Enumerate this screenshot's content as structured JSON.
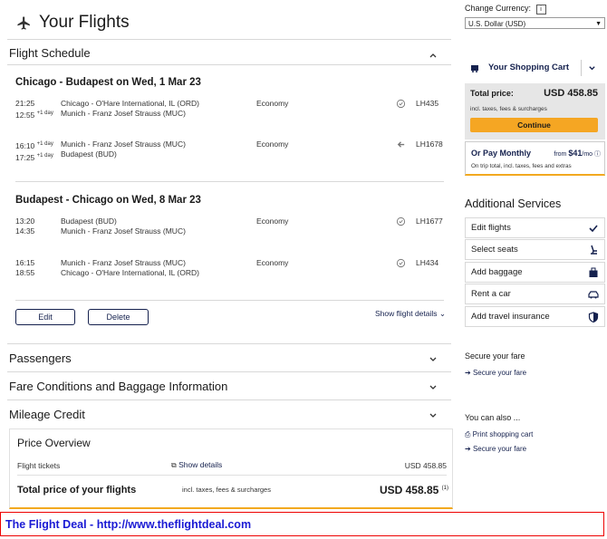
{
  "header": {
    "title": "Your Flights",
    "plane_icon": "plane-icon"
  },
  "schedule": {
    "section_title": "Flight Schedule",
    "outbound": {
      "route": "Chicago - Budapest on Wed, 1 Mar 23",
      "segments": [
        {
          "dep_time": "21:25",
          "dep_suffix": "",
          "arr_time": "12:55",
          "arr_suffix": "+1 day",
          "from": "Chicago - O'Hare International, IL (ORD)",
          "to": "Munich - Franz Josef Strauss (MUC)",
          "cabin": "Economy",
          "flight": "LH435",
          "icon": "clock-icon"
        },
        {
          "dep_time": "16:10",
          "dep_suffix": "+1 day",
          "arr_time": "17:25",
          "arr_suffix": "+1 day",
          "from": "Munich - Franz Josef Strauss (MUC)",
          "to": "Budapest (BUD)",
          "cabin": "Economy",
          "flight": "LH1678",
          "icon": "arrow-left-icon"
        }
      ]
    },
    "inbound": {
      "route": "Budapest - Chicago on Wed, 8 Mar 23",
      "segments": [
        {
          "dep_time": "13:20",
          "dep_suffix": "",
          "arr_time": "14:35",
          "arr_suffix": "",
          "from": "Budapest (BUD)",
          "to": "Munich - Franz Josef Strauss (MUC)",
          "cabin": "Economy",
          "flight": "LH1677",
          "icon": "clock-icon"
        },
        {
          "dep_time": "16:15",
          "dep_suffix": "",
          "arr_time": "18:55",
          "arr_suffix": "",
          "from": "Munich - Franz Josef Strauss (MUC)",
          "to": "Chicago - O'Hare International, IL (ORD)",
          "cabin": "Economy",
          "flight": "LH434",
          "icon": "clock-icon"
        }
      ]
    },
    "edit_label": "Edit",
    "delete_label": "Delete",
    "show_details_label": "Show flight details"
  },
  "sections": {
    "passengers": "Passengers",
    "fare_conditions": "Fare Conditions and Baggage Information",
    "mileage": "Mileage Credit"
  },
  "price_overview": {
    "title": "Price Overview",
    "tickets_label": "Flight tickets",
    "show_details": "Show details",
    "tickets_value": "USD 458.85",
    "total_label": "Total price of your flights",
    "total_note": "incl. taxes, fees & surcharges",
    "total_value": "USD 458.85",
    "footnote": "(1)"
  },
  "sidebar": {
    "currency_label": "Change Currency:",
    "currency_info": "i",
    "currency_value": "U.S. Dollar (USD)",
    "cart_title": "Your Shopping Cart",
    "total_price_label": "Total price:",
    "total_price_value": "USD 458.85",
    "total_note": "incl. taxes, fees & surcharges",
    "continue_label": "Continue",
    "monthly_label": "Or Pay Monthly",
    "monthly_from": "from",
    "monthly_value": "$41",
    "monthly_unit": "/mo",
    "monthly_note": "On trip total, incl. taxes, fees and extras",
    "additional_title": "Additional Services",
    "services": [
      {
        "label": "Edit flights",
        "icon": "checkmark-icon"
      },
      {
        "label": "Select seats",
        "icon": "seat-icon"
      },
      {
        "label": "Add baggage",
        "icon": "suitcase-icon"
      },
      {
        "label": "Rent a car",
        "icon": "car-icon"
      },
      {
        "label": "Add travel insurance",
        "icon": "shield-icon"
      }
    ],
    "secure_title": "Secure your fare",
    "secure_link": "Secure your fare",
    "also_title": "You can also ...",
    "print_link": "Print shopping cart",
    "secure_link2": "Secure your fare"
  },
  "footer": {
    "text": "The Flight Deal - http://www.theflightdeal.com"
  },
  "colors": {
    "brand": "#15214e",
    "accent": "#f5a623",
    "footer_text": "#1a1ad4",
    "footer_border": "#ee0000"
  }
}
